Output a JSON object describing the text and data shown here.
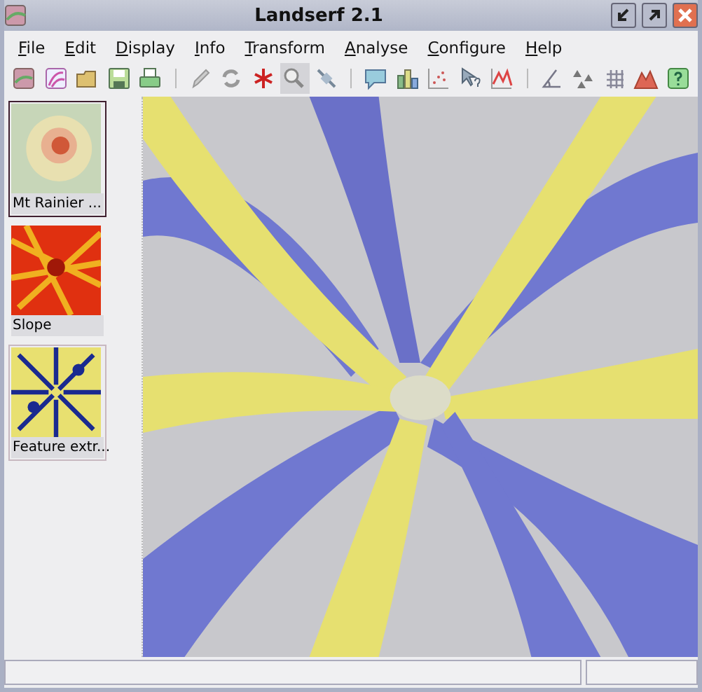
{
  "window": {
    "title": "Landserf 2.1"
  },
  "menu": [
    "File",
    "Edit",
    "Display",
    "Info",
    "Transform",
    "Analyse",
    "Configure",
    "Help"
  ],
  "toolbar": [
    [
      {
        "pressed": false
      },
      {
        "pressed": false
      },
      {
        "pressed": false
      },
      {
        "pressed": false
      },
      {
        "pressed": false
      }
    ],
    [
      {
        "pressed": false
      },
      {
        "pressed": false
      },
      {
        "pressed": false
      },
      {
        "pressed": true
      },
      {
        "pressed": false
      }
    ],
    [
      {
        "pressed": false
      },
      {
        "pressed": false
      },
      {
        "pressed": false
      },
      {
        "pressed": false
      },
      {
        "pressed": false
      }
    ],
    [
      {
        "pressed": false
      },
      {
        "pressed": false
      },
      {
        "pressed": false
      },
      {
        "pressed": false
      },
      {
        "pressed": false
      }
    ]
  ],
  "sidebar": {
    "items": [
      {
        "label": "Mt Rainier ...",
        "selected": true,
        "kind": "elevation"
      },
      {
        "label": "Slope",
        "selected": false,
        "kind": "slope"
      },
      {
        "label": "Feature extr...",
        "selected": false,
        "kind": "features"
      }
    ]
  }
}
